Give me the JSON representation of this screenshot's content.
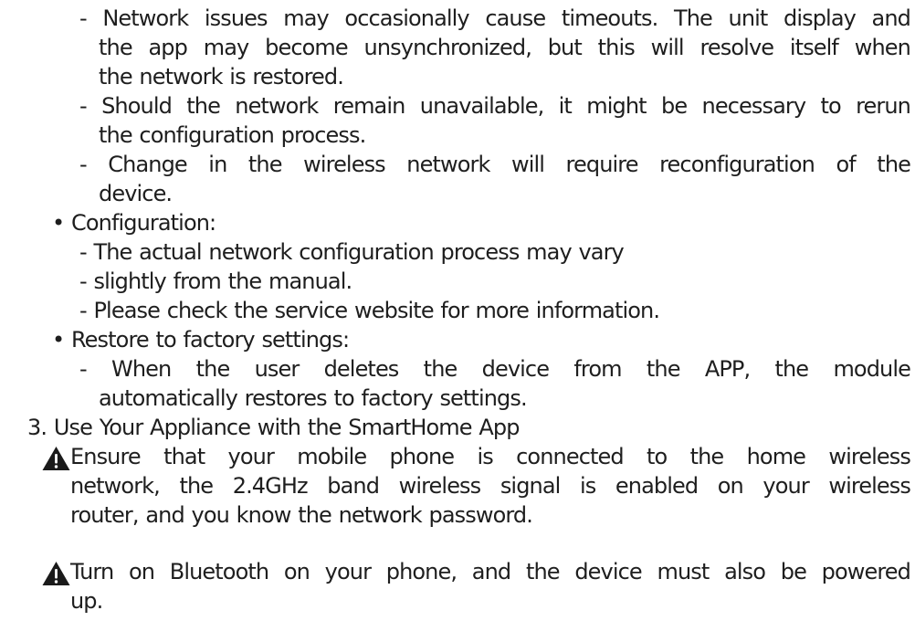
{
  "manual": {
    "network_notes": {
      "items": [
        {
          "lines": [
            "- Network issues may occasionally cause timeouts. The unit display and",
            "the app may become unsynchronized, but this will resolve itself when",
            "the network is restored."
          ]
        },
        {
          "lines": [
            "- Should the network remain unavailable, it might be necessary to rerun",
            "the configuration process."
          ]
        },
        {
          "lines": [
            "- Change in the wireless network will require reconfiguration of the",
            "device."
          ]
        }
      ]
    },
    "configuration": {
      "heading": "• Configuration:",
      "items": [
        "- The actual network configuration process may vary",
        "- slightly from the manual.",
        "- Please check the service website for more information."
      ]
    },
    "factory_reset": {
      "heading": "• Restore to factory settings:",
      "item_lines": [
        "- When the user deletes the device from the APP, the module",
        "automatically restores to factory settings."
      ]
    },
    "section3": {
      "heading": "3. Use Your Appliance with the SmartHome App",
      "warnings": [
        {
          "icon": "warning-triangle-icon",
          "lines": [
            "Ensure that your mobile phone is connected to the home wireless",
            "network, the 2.4GHz band wireless signal is enabled on your wireless",
            "router, and you know the network password."
          ]
        },
        {
          "icon": "warning-triangle-icon",
          "lines": [
            "Turn on Bluetooth on your phone, and the device must also be powered",
            "up."
          ]
        }
      ]
    }
  }
}
